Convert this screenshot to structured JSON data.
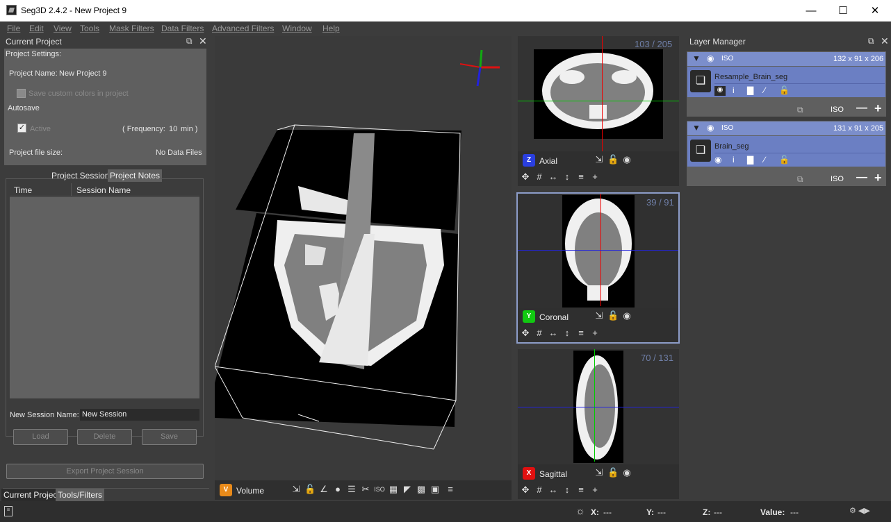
{
  "window": {
    "title": "Seg3D 2.4.2 - New Project 9"
  },
  "menu": [
    "File",
    "Edit",
    "View",
    "Tools",
    "Mask Filters",
    "Data Filters",
    "Advanced Filters",
    "Window",
    "Help"
  ],
  "project": {
    "panel_title": "Current Project",
    "settings_label": "Project Settings:",
    "name_label": "Project Name:",
    "name_value": "New Project 9",
    "save_colors_label": "Save custom colors in project",
    "autosave_label": "Autosave",
    "active_label": "Active",
    "frequency_label": "( Frequency:",
    "frequency_value": "10",
    "frequency_unit": "min )",
    "file_size_label": "Project file size:",
    "file_size_value": "No Data Files",
    "tabs": [
      "Project Sessions",
      "Project Notes"
    ],
    "columns": [
      "Time",
      "Session Name"
    ],
    "new_session_label": "New Session Name:",
    "new_session_value": "New Session",
    "buttons": {
      "load": "Load",
      "delete": "Delete",
      "save": "Save"
    },
    "export_label": "Export Project Session",
    "bottom_tabs": [
      "Current Project",
      "Tools/Filters"
    ]
  },
  "viewers": {
    "volume": {
      "badge": "V",
      "label": "Volume"
    },
    "axial": {
      "badge": "Z",
      "label": "Axial",
      "slice": "103 / 205",
      "color": "#2a3fe0"
    },
    "coronal": {
      "badge": "Y",
      "label": "Coronal",
      "slice": "39 / 91",
      "color": "#11c911"
    },
    "sagittal": {
      "badge": "X",
      "label": "Sagittal",
      "slice": "70 / 131",
      "color": "#e01010"
    }
  },
  "layer_manager": {
    "title": "Layer Manager",
    "groups": [
      {
        "iso": "ISO",
        "dims": "132 x 91 x 206",
        "layer": "Resample_Brain_seg",
        "footer_iso": "ISO"
      },
      {
        "iso": "ISO",
        "dims": "131 x 91 x 205",
        "layer": "Brain_seg",
        "footer_iso": "ISO"
      }
    ]
  },
  "status": {
    "x_label": "X:",
    "x_value": "---",
    "y_label": "Y:",
    "y_value": "---",
    "z_label": "Z:",
    "z_value": "---",
    "value_label": "Value:",
    "value_value": "---"
  }
}
